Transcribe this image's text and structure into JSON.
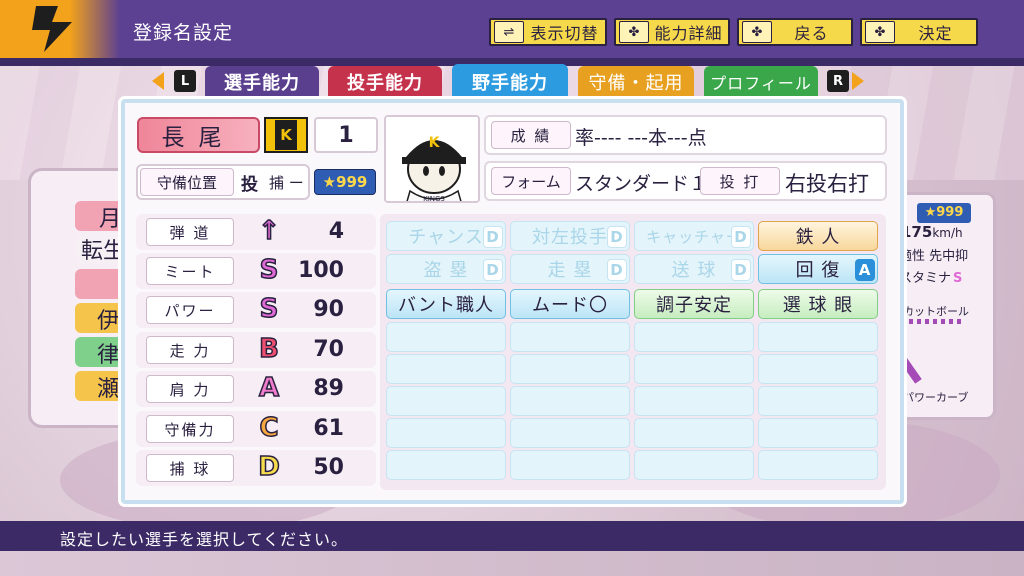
{
  "header": {
    "title": "登録名設定",
    "buttons": [
      {
        "icon": "⇌",
        "label": "表示切替",
        "icon_name": "toggle-icon"
      },
      {
        "icon": "✤",
        "label": "能力詳細",
        "icon_name": "dpad-icon"
      },
      {
        "icon": "✤",
        "label": "戻る",
        "icon_name": "dpad-icon"
      },
      {
        "icon": "✤",
        "label": "決定",
        "icon_name": "dpad-icon"
      }
    ]
  },
  "tabs": {
    "left_key": "L",
    "right_key": "R",
    "items": [
      {
        "label": "選手能力",
        "color": "#5a3f8e",
        "active": false
      },
      {
        "label": "投手能力",
        "color": "#c5324c",
        "active": false
      },
      {
        "label": "野手能力",
        "color": "#2d9be0",
        "active": true
      },
      {
        "label": "守備・起用",
        "color": "#e8a020",
        "active": false
      },
      {
        "label": "プロフィール",
        "color": "#3aa84a",
        "active": false
      }
    ]
  },
  "player": {
    "name": "長尾",
    "team_letter": "K",
    "number": "1",
    "position_label": "守備位置",
    "position_main": "投",
    "position_sub": "捕 ー",
    "rating": "999",
    "cap_letter": "K",
    "jersey_text": "KINGS",
    "record_label": "成 績",
    "record_value": "率---- ---本---点",
    "form_label": "フォーム",
    "form_value": "スタンダード１",
    "bat_label": "投 打",
    "bat_value": "右投右打"
  },
  "abilities": [
    {
      "label": "弾 道",
      "grade": "↑",
      "value": "4",
      "color": "#e06bd6"
    },
    {
      "label": "ミート",
      "grade": "S",
      "value": "100",
      "color": "#e06bd6"
    },
    {
      "label": "パワー",
      "grade": "S",
      "value": "90",
      "color": "#e06bd6"
    },
    {
      "label": "走 力",
      "grade": "B",
      "value": "70",
      "color": "#ef4f6e"
    },
    {
      "label": "肩 力",
      "grade": "A",
      "value": "89",
      "color": "#f07ccc"
    },
    {
      "label": "守備力",
      "grade": "C",
      "value": "61",
      "color": "#f7a740"
    },
    {
      "label": "捕 球",
      "grade": "D",
      "value": "50",
      "color": "#f6db4a"
    }
  ],
  "skills": [
    {
      "label": "チャンス",
      "badge": "D",
      "style": "dim"
    },
    {
      "label": "対左投手",
      "badge": "D",
      "style": "dim"
    },
    {
      "label": "キャッチャー",
      "badge": "D",
      "style": "dim"
    },
    {
      "label": "鉄 人",
      "badge": "",
      "style": "gold"
    },
    {
      "label": "盗 塁",
      "badge": "D",
      "style": "dim"
    },
    {
      "label": "走 塁",
      "badge": "D",
      "style": "dim"
    },
    {
      "label": "送 球",
      "badge": "D",
      "style": "dim"
    },
    {
      "label": "回 復",
      "badge": "A",
      "style": "bluegr"
    },
    {
      "label": "バント職人",
      "badge": "",
      "style": "blue"
    },
    {
      "label": "ムード〇",
      "badge": "",
      "style": "blue"
    },
    {
      "label": "調子安定",
      "badge": "",
      "style": "green"
    },
    {
      "label": "選 球 眼",
      "badge": "",
      "style": "green"
    }
  ],
  "right_panel": {
    "rating": "999",
    "speed": "175",
    "speed_unit": "km/h",
    "line1": "適性 先中抑",
    "line2": "スタミナ",
    "stamina_grade": "S",
    "pitch1": "カットボール",
    "pitch2": "パワーカーブ"
  },
  "left_panel": {
    "chars": [
      "月",
      "転生",
      "",
      "伊",
      "律",
      "瀬"
    ]
  },
  "footer": {
    "message": "設定したい選手を選択してください。"
  }
}
